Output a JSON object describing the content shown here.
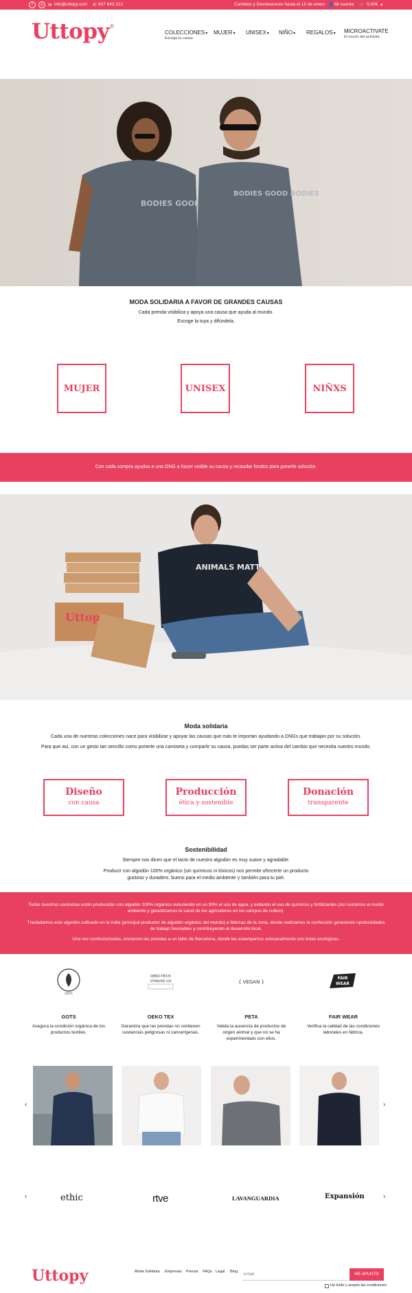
{
  "topbar": {
    "email": "info@uttopy.com",
    "phone": "607 643 212",
    "promo": "Cambios y Devoluciones hasta el 15 de enero",
    "account": "Mi cuenta",
    "cart": "0,00€"
  },
  "brand": {
    "logo": "Uttopy",
    "registered": "®"
  },
  "nav": [
    {
      "label": "COLECCIONES",
      "sub": "Escoge tu causa"
    },
    {
      "label": "MUJER",
      "sub": ""
    },
    {
      "label": "UNISEX",
      "sub": ""
    },
    {
      "label": "NIÑO",
      "sub": ""
    },
    {
      "label": "REGALOS",
      "sub": ""
    },
    {
      "label": "MICROACTIVATE",
      "sub": "El rincón del activista"
    }
  ],
  "hero": {
    "shirt_text": "BODIES GOOD BODIES"
  },
  "intro": {
    "title": "MODA SOLIDARIA A FAVOR DE GRANDES CAUSAS",
    "line1": "Cada prenda visibiliza y apoya una causa que ayuda al mundo.",
    "line2": "Escoge la tuya y difúndela."
  },
  "categories": [
    "MUJER",
    "UNISEX",
    "NIÑXS"
  ],
  "band1": "Con cada compra ayudas a una ONG a hacer visible su causa y recaudar fondos para ponerle solución.",
  "photo2": {
    "box_logo": "Uttopy",
    "shirt_text": "ANIMALS MATTER"
  },
  "moda": {
    "title": "Moda solidaria",
    "line1": "Cada una de nuestras colecciones nace para visibilizar y apoyar las causas que más te importan ayudando a ONGs que trabajan por su solución.",
    "line2": "Para que así, con un gesto tan sencillo como ponerte una camiseta y compartir su causa, puedas ser parte activa del cambio que necesita nuestro mundo."
  },
  "values": [
    {
      "title": "Diseño",
      "sub": "con causa"
    },
    {
      "title": "Producción",
      "sub": "ética y sostenible"
    },
    {
      "title": "Donación",
      "sub": "transparente"
    }
  ],
  "sostenibilidad": {
    "title": "Sostenibilidad",
    "line1": "Siempre nos dicen que el tacto de nuestro algodón es muy suave y agradable.",
    "line2": "Producir con algodón 100% orgánico (sin químicos ni tóxicos) nos permite ofrecerte un producto gustoso y duradero, bueno para el medio ambiente y también para tu piel."
  },
  "band2": {
    "p1": "Todas nuestras camisetas están producidas con algodón 100% orgánico reduciendo en un 90% el uso de agua, y evitando el uso de químicos y fertilizantes (así cuidamos el medio ambiente y garantizamos la salud de los agricultores en los campos de cultivo).",
    "p2": "Trasladamos este algodón cultivado en la India (principal productor de algodón orgánico del mundo) a fábricas de la zona, donde realizamos la confección generando oportunidades de trabajo favorables y contribuyendo al desarrollo local.",
    "p3": "Una vez confeccionadas, enviamos las prendas a un taller de Barcelona, donde las estampamos artesanalmente con tintas ecológicas."
  },
  "certs": [
    {
      "name": "GOTS",
      "desc": "Asegura la condición orgánica de los productos textiles.",
      "badge": "GLOBAL ORGANIC TEXTILE STANDARD · GOTS"
    },
    {
      "name": "OEKO TEX",
      "desc": "Garantiza que las prendas no contienen sustancias peligrosas ni cancerígenas.",
      "badge": "OEKO-TEX® STANDARD 100"
    },
    {
      "name": "PETA",
      "desc": "Valida la ausencia de productos de origen animal y que no se ha experimentado con ellos.",
      "badge": "VEGAN"
    },
    {
      "name": "FAIR WEAR",
      "desc": "Verifica la calidad de las condiciones laborales en fábrica.",
      "badge": "FAIR WEAR"
    }
  ],
  "carousel": {
    "prev": "‹",
    "next": "›"
  },
  "press": [
    "ethic",
    "rtve",
    "LAVANGUARDIA",
    "Expansión"
  ],
  "footer": {
    "logo": "Uttopy",
    "links": [
      "Moda Solidaria",
      "Empresas",
      "Prensa",
      "FAQs",
      "Legal",
      "Blog"
    ],
    "email_placeholder": "Email",
    "subscribe": "ME APUNTO",
    "terms": "He leído y acepto las condiciones"
  },
  "colors": {
    "accent": "#e8405e"
  }
}
